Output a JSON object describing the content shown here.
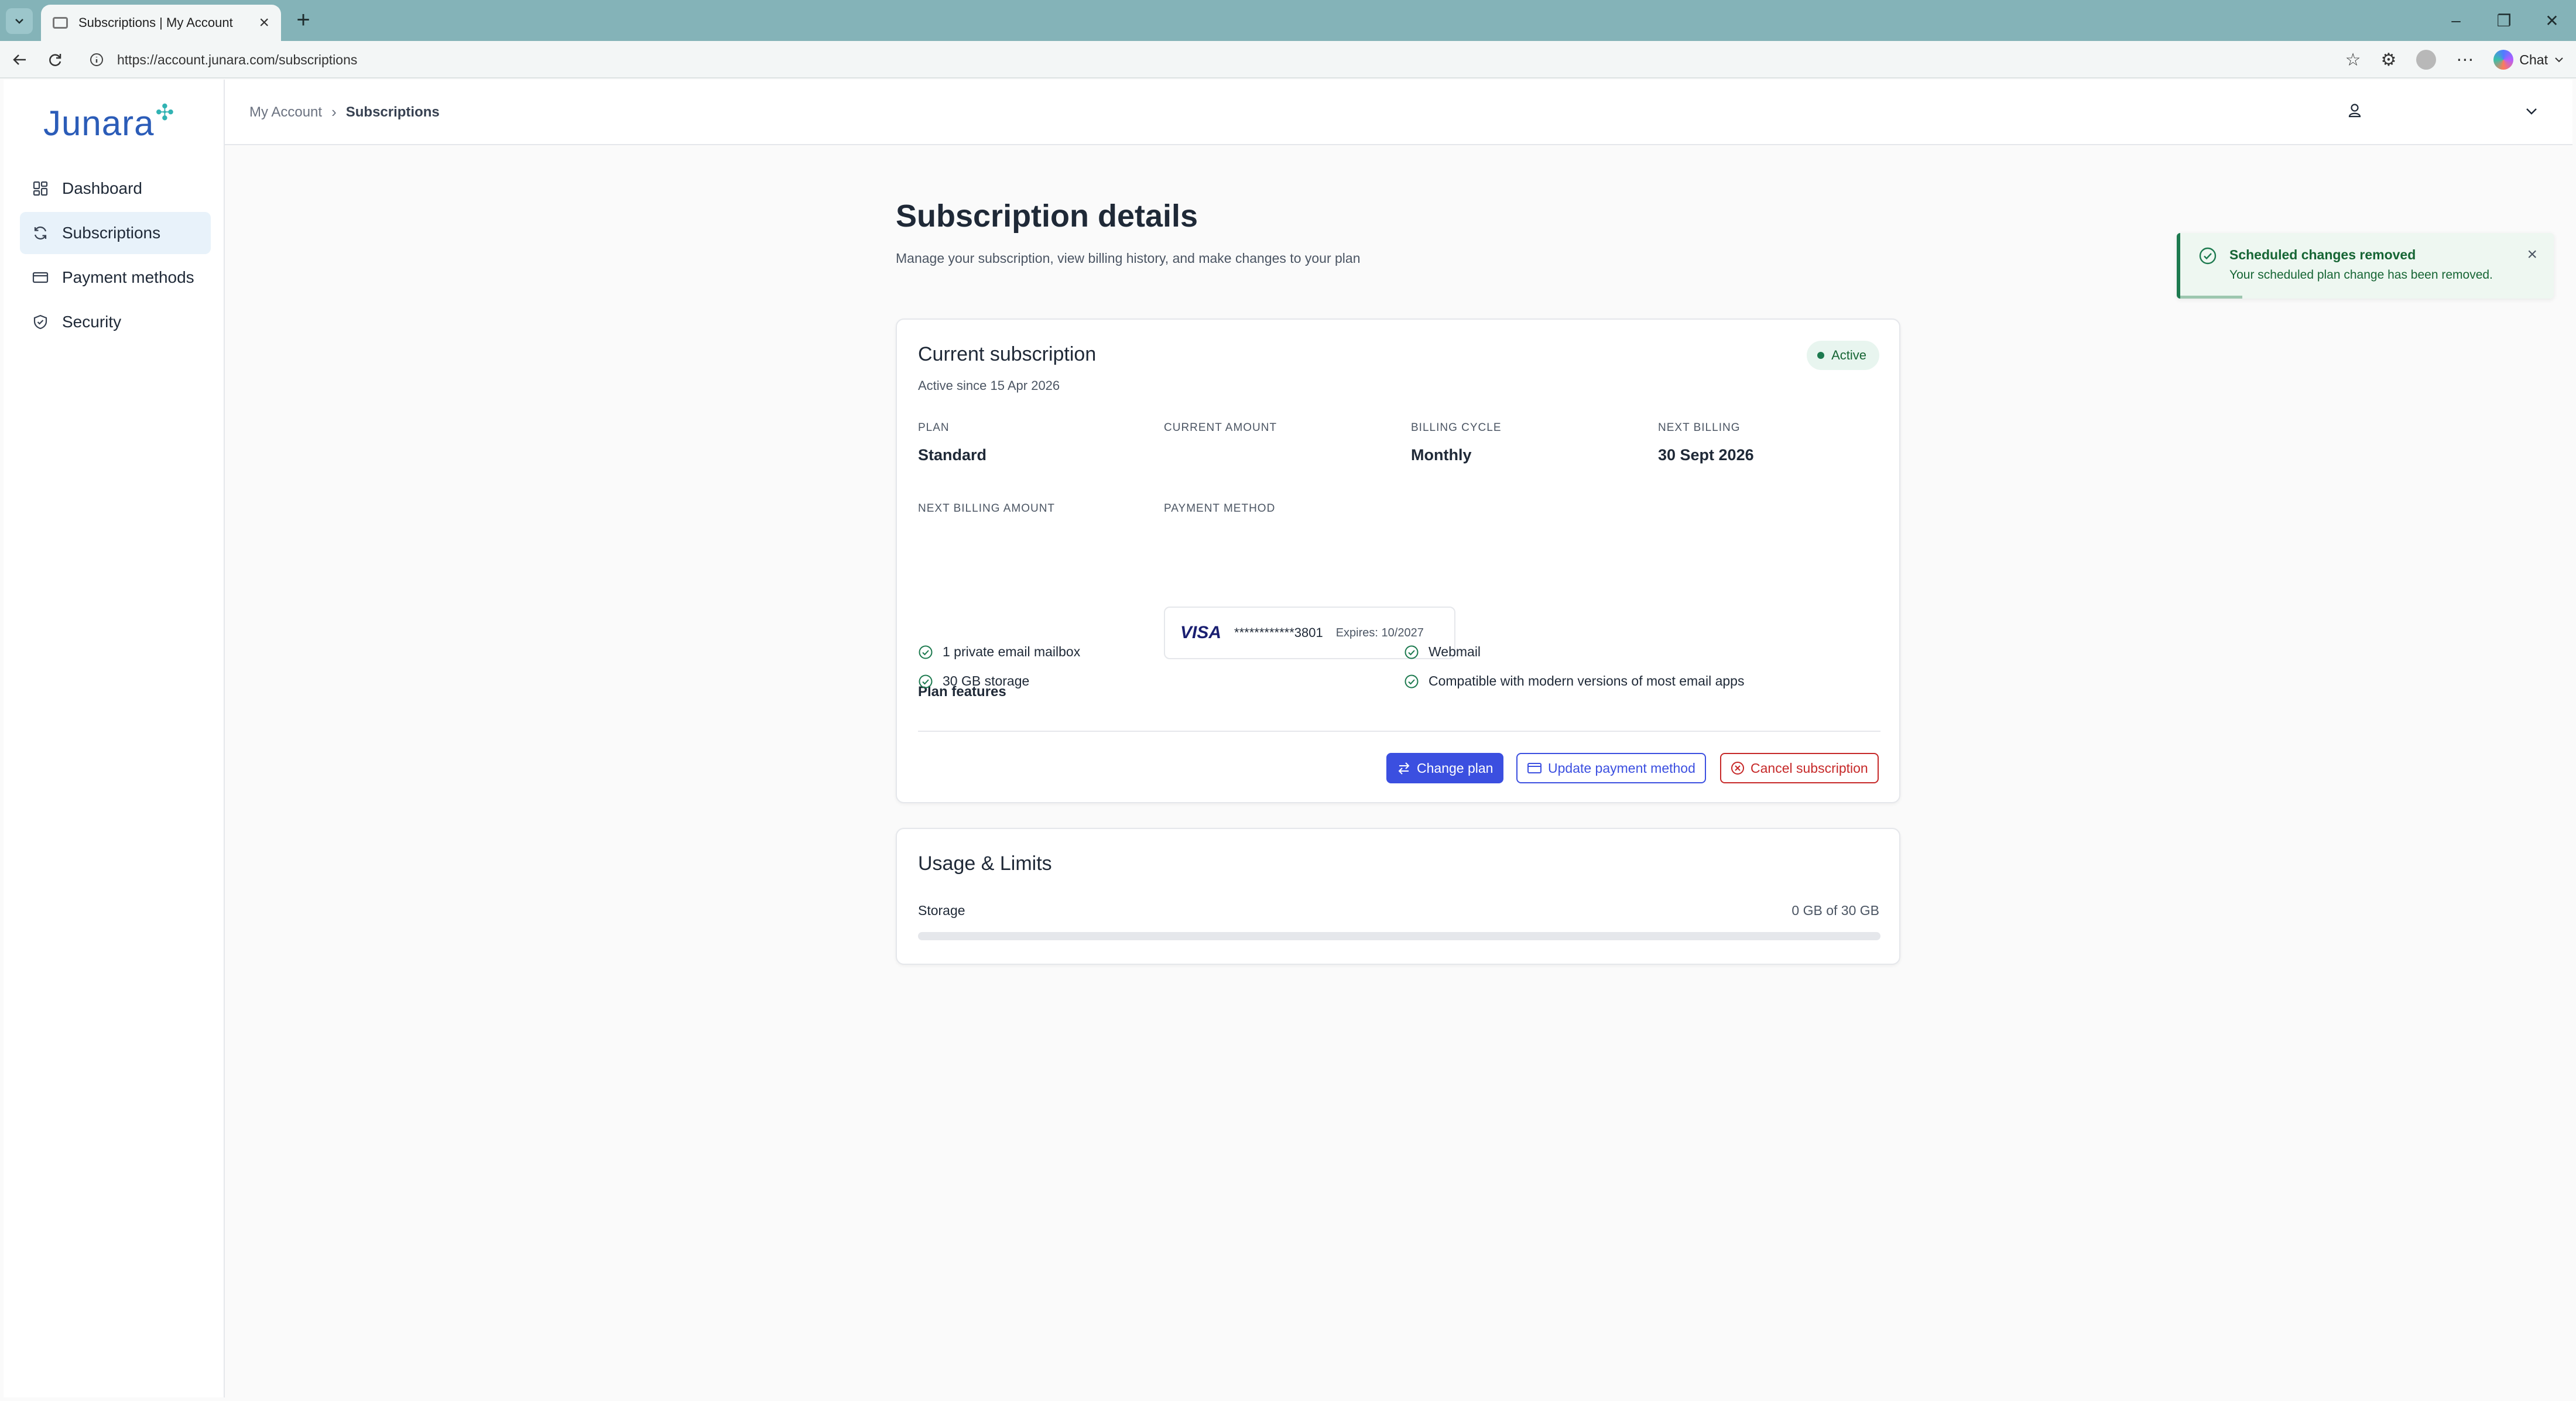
{
  "browser": {
    "tab_title": "Subscriptions | My Account",
    "url": "https://account.junara.com/subscriptions",
    "chat_label": "Chat"
  },
  "sidebar": {
    "brand": "Junara",
    "items": [
      {
        "label": "Dashboard",
        "icon": "dashboard-icon",
        "active": false
      },
      {
        "label": "Subscriptions",
        "icon": "refresh-icon",
        "active": true
      },
      {
        "label": "Payment methods",
        "icon": "credit-card-icon",
        "active": false
      },
      {
        "label": "Security",
        "icon": "shield-icon",
        "active": false
      }
    ]
  },
  "breadcrumb": {
    "root": "My Account",
    "current": "Subscriptions"
  },
  "page": {
    "title": "Subscription details",
    "subtitle": "Manage your subscription, view billing history, and make changes to your plan"
  },
  "subscription": {
    "title": "Current subscription",
    "active_since": "Active since 15 Apr 2026",
    "status": "Active",
    "fields": {
      "plan_label": "PLAN",
      "plan_value": "Standard",
      "amount_label": "CURRENT AMOUNT",
      "amount_value": "",
      "cycle_label": "BILLING CYCLE",
      "cycle_value": "Monthly",
      "next_billing_label": "NEXT BILLING",
      "next_billing_value": "30 Sept 2026",
      "next_amount_label": "NEXT BILLING AMOUNT",
      "next_amount_value": "",
      "payment_label": "PAYMENT METHOD"
    },
    "payment_method": {
      "brand": "VISA",
      "number": "************3801",
      "expires": "Expires: 10/2027"
    },
    "features_title": "Plan features",
    "features": [
      "1 private email mailbox",
      "30 GB storage",
      "Webmail",
      "Compatible with modern versions of most email apps"
    ],
    "actions": {
      "change_plan": "Change plan",
      "update_payment": "Update payment method",
      "cancel": "Cancel subscription"
    }
  },
  "usage": {
    "title": "Usage & Limits",
    "storage_label": "Storage",
    "storage_value": "0 GB of 30 GB",
    "storage_used_fraction": 0
  },
  "toast": {
    "title": "Scheduled changes removed",
    "message": "Your scheduled plan change has been removed."
  },
  "colors": {
    "accent": "#3b4fe0",
    "brand": "#2b5cb8",
    "success": "#1d7a4f",
    "danger": "#c62828"
  }
}
